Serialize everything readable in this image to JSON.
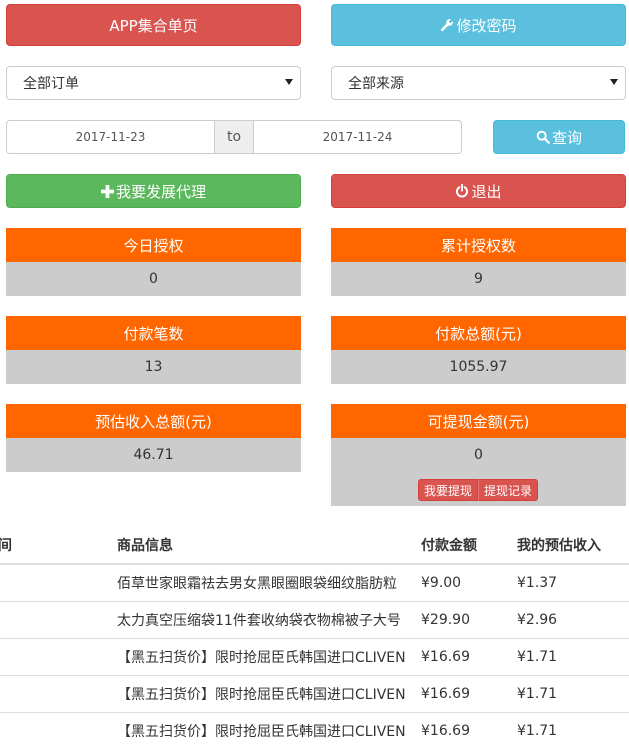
{
  "buttons": {
    "app_pages": "APP集合单页",
    "change_password": "修改密码",
    "search": "查询",
    "develop_agent": "我要发展代理",
    "logout": "退出"
  },
  "filters": {
    "order_select": "全部订单",
    "source_select": "全部来源",
    "date_from": "2017-11-23",
    "date_sep": "to",
    "date_to": "2017-11-24"
  },
  "stats": {
    "today_auth": {
      "label": "今日授权",
      "value": "0"
    },
    "total_auth": {
      "label": "累计授权数",
      "value": "9"
    },
    "pay_count": {
      "label": "付款笔数",
      "value": "13"
    },
    "pay_total": {
      "label": "付款总额(元)",
      "value": "1055.97"
    },
    "est_income": {
      "label": "预估收入总额(元)",
      "value": "46.71"
    },
    "withdrawable": {
      "label": "可提现金额(元)",
      "value": "0"
    }
  },
  "withdraw": {
    "apply": "我要提现",
    "records": "提现记录"
  },
  "table": {
    "headers": [
      "时间",
      "商品信息",
      "付款金额",
      "我的预估收入"
    ],
    "rows": [
      {
        "time": "",
        "goods": "佰草世家眼霜祛去男女黑眼圈眼袋细纹脂肪粒",
        "pay": "¥9.00",
        "income": "¥1.37"
      },
      {
        "time": "",
        "goods": "太力真空压缩袋11件套收纳袋衣物棉被子大号",
        "pay": "¥29.90",
        "income": "¥2.96"
      },
      {
        "time": "",
        "goods": "【黑五扫货价】限时抢屈臣氏韩国进口CLIVEN",
        "pay": "¥16.69",
        "income": "¥1.71"
      },
      {
        "time": "",
        "goods": "【黑五扫货价】限时抢屈臣氏韩国进口CLIVEN",
        "pay": "¥16.69",
        "income": "¥1.71"
      },
      {
        "time": "",
        "goods": "【黑五扫货价】限时抢屈臣氏韩国进口CLIVEN",
        "pay": "¥16.69",
        "income": "¥1.71"
      }
    ]
  },
  "colors": {
    "danger": "#d9534f",
    "info": "#5bc0de",
    "success": "#5cb85c",
    "stat_head": "#ff6600",
    "stat_body": "#cccccc"
  },
  "icons": {
    "change_password": "wrench-icon",
    "search": "search-icon",
    "develop_agent": "plus-icon",
    "logout": "power-icon",
    "select": "caret-down-icon"
  }
}
